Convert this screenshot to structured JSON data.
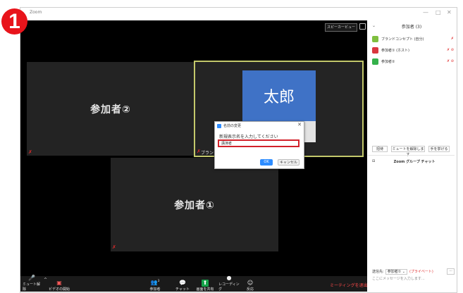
{
  "step_badge": "1",
  "window": {
    "title": "Zoom",
    "controls": {
      "minimize": "—",
      "maximize": "□",
      "close": "✕"
    }
  },
  "video": {
    "speaker_view_label": "スピーカービュー",
    "tiles": {
      "participant2": "参加者②",
      "participant1": "参加者①",
      "taro": "太郎",
      "brand_label": "ブランド"
    },
    "mute_glyph": "✗"
  },
  "dialog": {
    "title": "名前の変更",
    "close": "✕",
    "prompt": "新規表示名を入力してください",
    "input_value": "講演者",
    "ok": "OK",
    "cancel": "キャンセル"
  },
  "toolbar": {
    "items": [
      {
        "label": "ミュート解除",
        "icon": "🎤"
      },
      {
        "label": "ビデオの開始",
        "icon": "▣"
      },
      {
        "label": "参加者",
        "icon": "👥",
        "count": "3"
      },
      {
        "label": "チャット",
        "icon": "💬"
      },
      {
        "label": "画面を共有",
        "icon": "⬆"
      },
      {
        "label": "レコーディング",
        "icon": "●"
      },
      {
        "label": "反応",
        "icon": "☺"
      }
    ],
    "chevron": "^",
    "end_meeting": "ミーティングを退出"
  },
  "panel": {
    "collapse": "⌄",
    "title": "参加者 (3)",
    "participants": [
      {
        "name": "ブランドコンセプト (自分)",
        "color": "#7fbf3f",
        "icons": "✗"
      },
      {
        "name": "参加者① (ホスト)",
        "color": "#d9363e",
        "icons": "✗ ⊘"
      },
      {
        "name": "参加者②",
        "color": "#35b14b",
        "icons": "✗ ⊘"
      }
    ],
    "buttons": {
      "invite": "招待",
      "mute_all": "ミュートを解除します",
      "raise_hand": "手を挙げる"
    },
    "chat_title": "Zoom グループ チャット",
    "chat_collapse": "⊟",
    "chat_to_label": "送信先:",
    "chat_to_value": "参加者① ⌄",
    "chat_private": "(プライベート)",
    "chat_more": "···",
    "chat_placeholder": "ここにメッセージを入力します..."
  },
  "colors": {
    "accent": "#2d8cff",
    "danger": "#e02b2b",
    "badge": "#e8141b",
    "active_border": "#c3c86b",
    "taro_card": "#3f72c6"
  }
}
